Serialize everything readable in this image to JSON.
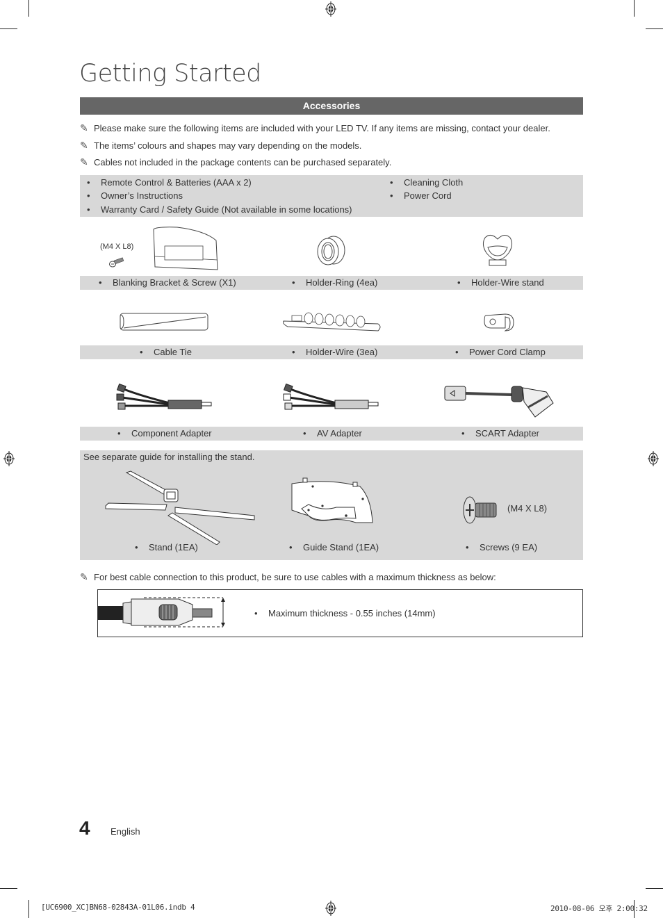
{
  "page": {
    "title": "Getting Started",
    "section_header": "Accessories",
    "notes": [
      "Please make sure the following items are included with your LED TV. If any items are missing, contact your dealer.",
      "The items’ colours and shapes may vary depending on the models.",
      "Cables not included in the package contents can be purchased separately."
    ],
    "note_icon": "pencil-note-icon",
    "bullet": "•",
    "included_items_left": [
      "Remote Control & Batteries (AAA x 2)",
      "Owner’s Instructions",
      "Warranty Card / Safety Guide (Not available in some locations)"
    ],
    "included_items_right": [
      "Cleaning Cloth",
      "Power Cord"
    ],
    "accessory_rows": [
      [
        "Blanking Bracket & Screw (X1)",
        "Holder-Ring (4ea)",
        "Holder-Wire stand"
      ],
      [
        "Cable Tie",
        "Holder-Wire (3ea)",
        "Power Cord Clamp"
      ],
      [
        "Component Adapter",
        "AV Adapter",
        "SCART Adapter"
      ]
    ],
    "screw_spec_bracket": "(M4 X L8)",
    "stand_section": {
      "note": "See separate guide for installing the stand.",
      "items": [
        "Stand (1EA)",
        "Guide Stand (1EA)",
        "Screws (9 EA)"
      ],
      "screw_spec": "(M4 X L8)"
    },
    "cable_note": "For best cable connection to this product, be sure to use cables with a maximum thickness as below:",
    "max_thickness": "Maximum thickness - 0.55 inches (14mm)",
    "footer": {
      "page_number": "4",
      "language": "English",
      "file_slug": "[UC6900_XC]BN68-02843A-01L06.indb   4",
      "timestamp": "2010-08-06   오후 2:00:32"
    }
  }
}
